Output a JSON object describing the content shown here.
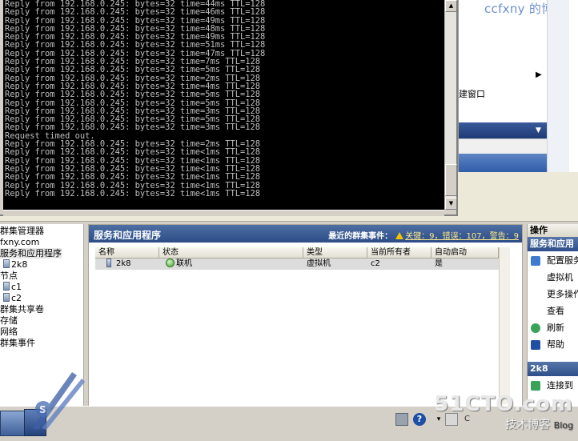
{
  "console": {
    "lines": [
      "Reply from 192.168.0.245: bytes=32 time=44ms TTL=128",
      "Reply from 192.168.0.245: bytes=32 time=46ms TTL=128",
      "Reply from 192.168.0.245: bytes=32 time=49ms TTL=128",
      "Reply from 192.168.0.245: bytes=32 time=48ms TTL=128",
      "Reply from 192.168.0.245: bytes=32 time=49ms TTL=128",
      "Reply from 192.168.0.245: bytes=32 time=51ms TTL=128",
      "Reply from 192.168.0.245: bytes=32 time=47ms TTL=128",
      "Reply from 192.168.0.245: bytes=32 time=7ms TTL=128",
      "Reply from 192.168.0.245: bytes=32 time=5ms TTL=128",
      "Reply from 192.168.0.245: bytes=32 time=2ms TTL=128",
      "Reply from 192.168.0.245: bytes=32 time=4ms TTL=128",
      "Reply from 192.168.0.245: bytes=32 time=5ms TTL=128",
      "Reply from 192.168.0.245: bytes=32 time=5ms TTL=128",
      "Reply from 192.168.0.245: bytes=32 time=3ms TTL=128",
      "Reply from 192.168.0.245: bytes=32 time=5ms TTL=128",
      "Reply from 192.168.0.245: bytes=32 time=3ms TTL=128",
      "Request timed out.",
      "Reply from 192.168.0.245: bytes=32 time=2ms TTL=128",
      "Reply from 192.168.0.245: bytes=32 time<1ms TTL=128",
      "Reply from 192.168.0.245: bytes=32 time<1ms TTL=128",
      "Reply from 192.168.0.245: bytes=32 time<1ms TTL=128",
      "Reply from 192.168.0.245: bytes=32 time<1ms TTL=128",
      "Reply from 192.168.0.245: bytes=32 time<1ms TTL=128",
      "Reply from 192.168.0.245: bytes=32 time<1ms TTL=128"
    ]
  },
  "background_window": {
    "brand": "ccfxny 的博",
    "label": "建窗口"
  },
  "tree": {
    "items": [
      {
        "label": "群集管理器",
        "icon": false
      },
      {
        "label": "fxny.com",
        "icon": false
      },
      {
        "label": "服务和应用程序",
        "icon": false,
        "selected": true
      },
      {
        "label": "2k8",
        "icon": true
      },
      {
        "label": "节点",
        "icon": false
      },
      {
        "label": "c1",
        "icon": true
      },
      {
        "label": "c2",
        "icon": true
      },
      {
        "label": "群集共享卷",
        "icon": false
      },
      {
        "label": "存储",
        "icon": false
      },
      {
        "label": "网络",
        "icon": false
      },
      {
        "label": "群集事件",
        "icon": false
      }
    ]
  },
  "main": {
    "title": "服务和应用程序",
    "events_label": "最近的群集事件：",
    "events_links": "关键：9，错误：107，警告：9",
    "columns": [
      "名称",
      "状态",
      "类型",
      "当前所有者",
      "自动启动"
    ],
    "rows": [
      {
        "name": "2k8",
        "status": "联机",
        "type": "虚拟机",
        "owner": "c2",
        "autostart": "是"
      }
    ]
  },
  "actions": {
    "title": "操作",
    "section1": "服务和应用",
    "items1": [
      {
        "label": "配置服务",
        "icon": "configure-icon"
      },
      {
        "label": "虚拟机",
        "icon": null
      },
      {
        "label": "更多操作",
        "icon": null
      },
      {
        "label": "查看",
        "icon": null
      },
      {
        "label": "刷新",
        "icon": "refresh-icon"
      },
      {
        "label": "帮助",
        "icon": "help-icon"
      }
    ],
    "section2": "2k8",
    "items2": [
      {
        "label": "连接到",
        "icon": "connect-icon"
      }
    ]
  },
  "taskbar": {
    "help": "?",
    "tray_text": "C"
  },
  "watermark": {
    "big": "51CTO.com",
    "small": "技术博客",
    "blog": "Blog"
  },
  "colors": {
    "console_bg": "#000000",
    "console_text": "#c0c0c0",
    "panel_header": "#3a5c95",
    "warning": "#f2c400",
    "online": "#3d9c2c"
  }
}
